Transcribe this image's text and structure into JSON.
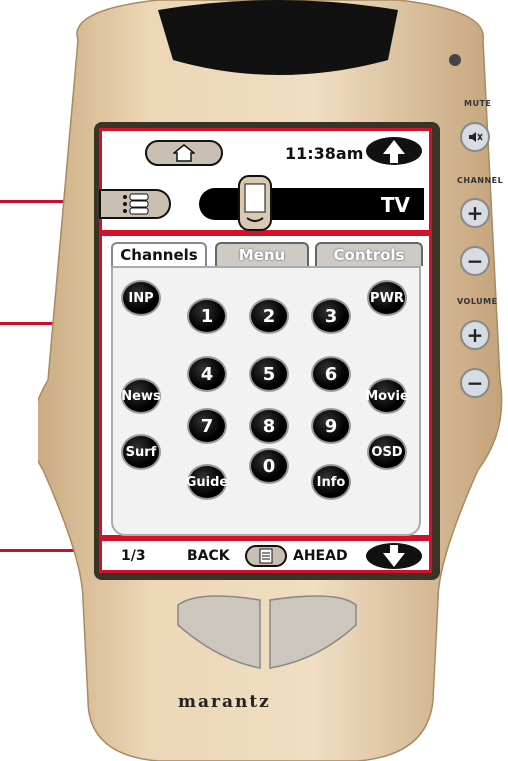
{
  "status": {
    "time": "11:38am"
  },
  "device": {
    "label": "TV"
  },
  "tabs": [
    {
      "label": "Channels",
      "active": true
    },
    {
      "label": "Menu",
      "active": false
    },
    {
      "label": "Controls",
      "active": false
    }
  ],
  "keys": {
    "inp": "INP",
    "pwr": "PWR",
    "news": "News",
    "movie": "Movie",
    "surf": "Surf",
    "osd": "OSD",
    "guide": "Guide",
    "info": "Info",
    "digits": [
      "1",
      "2",
      "3",
      "4",
      "5",
      "6",
      "7",
      "8",
      "9",
      "0"
    ]
  },
  "footer": {
    "page": "1/3",
    "back": "BACK",
    "ahead": "AHEAD"
  },
  "side": {
    "mute": "MUTE",
    "channel": "CHANNEL",
    "volume": "VOLUME",
    "plus": "+",
    "minus": "−",
    "mute_icon": "speaker-muted-icon"
  },
  "brand": "marantz",
  "colors": {
    "accent_red": "#d5102a",
    "body": "#e3c9a4",
    "screen_bg": "#ffffff"
  }
}
